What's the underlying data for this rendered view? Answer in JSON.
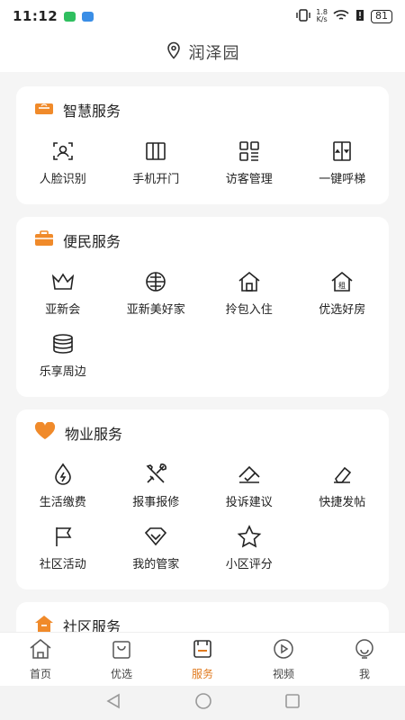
{
  "status_bar": {
    "time": "11:12",
    "net_speed_top": "1.8",
    "net_speed_unit": "K/s",
    "battery": "81"
  },
  "header": {
    "location_icon": "location-pin-icon",
    "title": "润泽园"
  },
  "sections": [
    {
      "title": "智慧服务",
      "icon": "router-icon",
      "items": [
        {
          "label": "人脸识别",
          "icon": "face-scan-icon"
        },
        {
          "label": "手机开门",
          "icon": "door-icon"
        },
        {
          "label": "访客管理",
          "icon": "grid-icon"
        },
        {
          "label": "一键呼梯",
          "icon": "elevator-icon"
        }
      ]
    },
    {
      "title": "便民服务",
      "icon": "toolbox-icon",
      "items": [
        {
          "label": "亚新会",
          "icon": "crown-icon"
        },
        {
          "label": "亚新美好家",
          "icon": "globe-icon"
        },
        {
          "label": "拎包入住",
          "icon": "house-icon"
        },
        {
          "label": "优选好房",
          "icon": "rent-house-icon"
        },
        {
          "label": "乐享周边",
          "icon": "coins-icon"
        }
      ]
    },
    {
      "title": "物业服务",
      "icon": "heart-icon",
      "items": [
        {
          "label": "生活缴费",
          "icon": "water-drop-icon"
        },
        {
          "label": "报事报修",
          "icon": "tools-icon"
        },
        {
          "label": "投诉建议",
          "icon": "complaint-icon"
        },
        {
          "label": "快捷发帖",
          "icon": "eraser-icon"
        },
        {
          "label": "社区活动",
          "icon": "flag-icon"
        },
        {
          "label": "我的管家",
          "icon": "diamond-icon"
        },
        {
          "label": "小区评分",
          "icon": "star-icon"
        }
      ]
    },
    {
      "title": "社区服务",
      "icon": "community-house-icon",
      "items": []
    }
  ],
  "tabs": [
    {
      "label": "首页",
      "icon": "home-icon",
      "active": false
    },
    {
      "label": "优选",
      "icon": "shopping-bag-icon",
      "active": false
    },
    {
      "label": "服务",
      "icon": "service-icon",
      "active": true
    },
    {
      "label": "视频",
      "icon": "play-icon",
      "active": false
    },
    {
      "label": "我",
      "icon": "profile-icon",
      "active": false
    }
  ],
  "colors": {
    "accent": "#e07a1f",
    "background": "#f5f5f5",
    "card": "#ffffff"
  }
}
